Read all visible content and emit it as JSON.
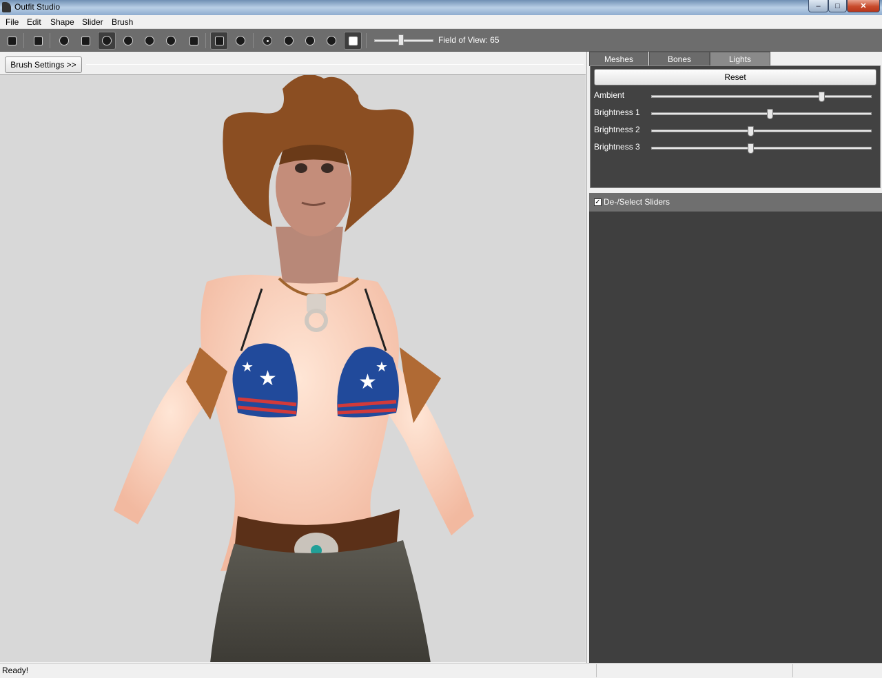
{
  "window": {
    "title": "Outfit Studio",
    "controls": {
      "minimize": "–",
      "maximize": "□",
      "close": "✕"
    }
  },
  "menu": [
    "File",
    "Edit",
    "Shape",
    "Slider",
    "Brush"
  ],
  "toolbar": {
    "fov_label": "Field of View: 65",
    "fov_value": 65,
    "tools": [
      "new-project-icon",
      "load-reference-icon",
      "select-brush-icon",
      "mask-brush-icon",
      "inflate-brush-icon",
      "deflate-brush-icon",
      "move-brush-icon",
      "smooth-brush-icon",
      "weight-brush-icon",
      "mirror-toggle-icon",
      "connected-icon",
      "vertex-dot-icon",
      "wireframe-icon",
      "lighting-icon",
      "textures-icon",
      "cube-view-icon"
    ]
  },
  "left": {
    "brush_settings_label": "Brush Settings >>"
  },
  "right": {
    "tabs": [
      "Meshes",
      "Bones",
      "Lights"
    ],
    "active_tab": "Lights",
    "reset_label": "Reset",
    "lights": [
      {
        "label": "Ambient",
        "value": 0.78
      },
      {
        "label": "Brightness 1",
        "value": 0.54
      },
      {
        "label": "Brightness 2",
        "value": 0.45
      },
      {
        "label": "Brightness 3",
        "value": 0.45
      }
    ],
    "sliders_header": "De-/Select Sliders",
    "sliders_checked": true
  },
  "status": {
    "text": "Ready!"
  },
  "colors": {
    "toolbar": "#6d6d6d",
    "panel_dark": "#424242",
    "viewport_bg": "#d8d8d8"
  }
}
